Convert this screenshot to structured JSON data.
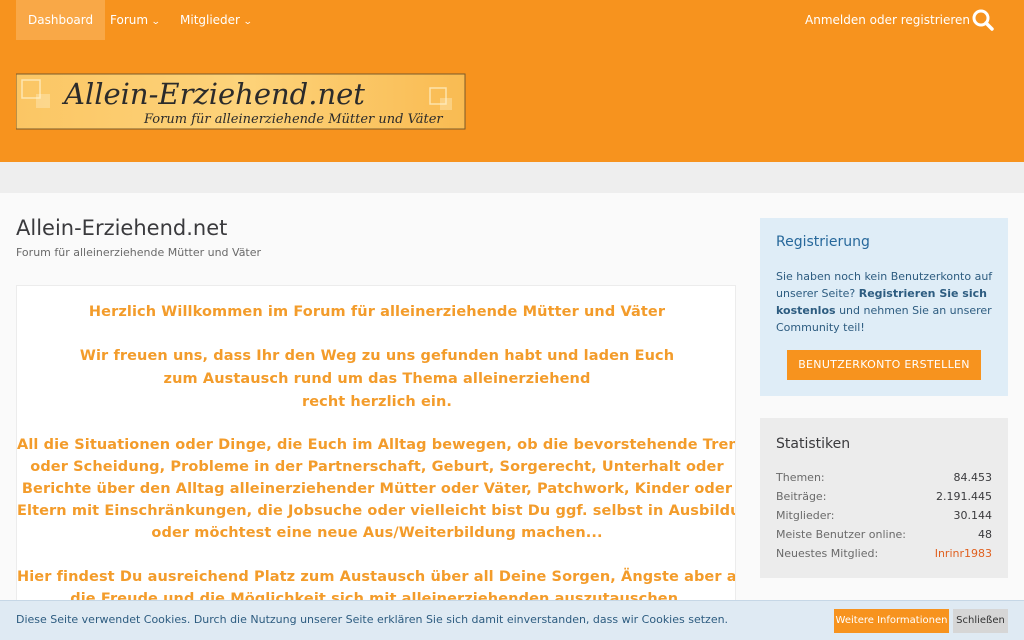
{
  "nav": {
    "items": [
      {
        "label": "Dashboard",
        "dropdown": false,
        "active": true
      },
      {
        "label": "Forum",
        "dropdown": true,
        "active": false
      },
      {
        "label": "Mitglieder",
        "dropdown": true,
        "active": false
      }
    ],
    "login_label": "Anmelden oder registrieren",
    "search_icon": "search-icon"
  },
  "logo": {
    "title": "Allein-Erziehend.net",
    "tagline": "Forum für alleinerziehende Mütter und Väter"
  },
  "page": {
    "title": "Allein-Erziehend.net",
    "subtitle": "Forum für alleinerziehende Mütter und Väter"
  },
  "welcome": {
    "lines": [
      "Herzlich Willkommen im Forum für alleinerziehende Mütter und Väter",
      "Wir freuen uns, dass Ihr den Weg zu uns gefunden habt und laden Euch",
      "zum Austausch rund um das Thema alleinerziehend",
      "recht herzlich ein.",
      "All die Situationen oder Dinge, die Euch im Alltag bewegen, ob die bevorstehende Trennung",
      "oder Scheidung, Probleme in der Partnerschaft, Geburt, Sorgerecht, Unterhalt oder",
      "Berichte über den Alltag alleinerziehender Mütter oder Väter, Patchwork, Kinder oder",
      "Eltern mit Einschränkungen, die Jobsuche oder vielleicht bist Du ggf. selbst in Ausbildung",
      "oder möchtest eine neue Aus/Weiterbildung machen...",
      "Hier findest Du ausreichend Platz zum Austausch über all Deine Sorgen, Ängste aber auch",
      "die Freude und die Möglichkeit sich mit alleinerziehenden auszutauschen."
    ]
  },
  "registration": {
    "title": "Registrierung",
    "text_1": "Sie haben noch kein Benutzerkonto auf unserer Seite?",
    "text_bold": "Registrieren Sie sich kostenlos",
    "text_2": "und nehmen Sie an unserer Community teil!",
    "button": "BENUTZERKONTO ERSTELLEN"
  },
  "stats": {
    "title": "Statistiken",
    "rows": [
      {
        "label": "Themen:",
        "value": "84.453"
      },
      {
        "label": "Beiträge:",
        "value": "2.191.445"
      },
      {
        "label": "Mitglieder:",
        "value": "30.144"
      },
      {
        "label": "Meiste Benutzer online:",
        "value": "48"
      },
      {
        "label": "Neuestes Mitglied:",
        "value": "Inrinr1983"
      }
    ]
  },
  "cookie": {
    "text": "Diese Seite verwendet Cookies. Durch die Nutzung unserer Seite erklären Sie sich damit einverstanden, dass wir Cookies setzen.",
    "info_button": "Weitere Informationen",
    "close_button": "Schließen"
  },
  "colors": {
    "brand": "#f7931e",
    "link": "#e0601f",
    "sidebar_blue": "#dfedf7"
  }
}
